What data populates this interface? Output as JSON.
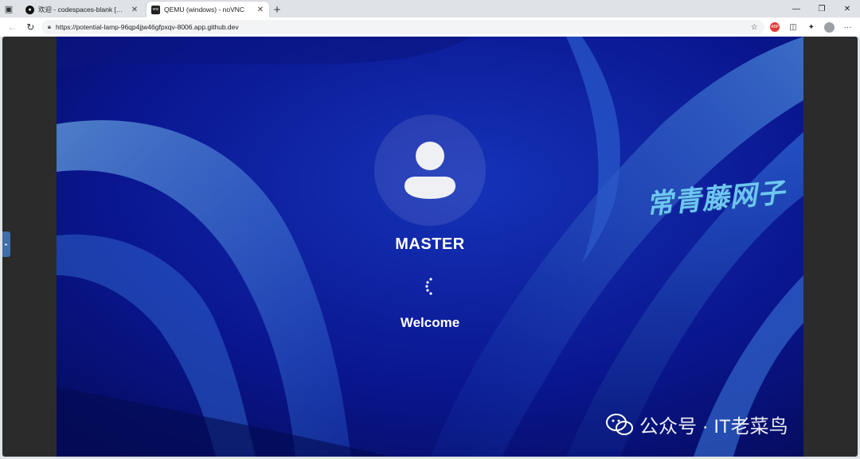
{
  "browser": {
    "tabs": [
      {
        "title": "欢迎 - codespaces-blank [Codes:",
        "favicon": "github-icon",
        "active": false
      },
      {
        "title": "QEMU (windows) - noVNC",
        "favicon": "novnc-icon",
        "active": true
      }
    ],
    "new_tab_label": "+",
    "url": "https://potential-lamp-96qp4jjw46gfpxqv-8006.app.github.dev",
    "ext_badge": "ABP"
  },
  "vnc": {
    "handle_glyph": "▸",
    "novnc_favicon_text": "vnc"
  },
  "login_screen": {
    "username": "MASTER",
    "status": "Welcome"
  },
  "overlays": {
    "watermark": "常青藤网子",
    "wechat_label": "公众号 · IT老菜鸟"
  },
  "colors": {
    "wallpaper_deep": "#0a128a",
    "wallpaper_mid": "#1a3fb8",
    "ribbon_light": "#4a90d8",
    "watermark": "#6ec6f2"
  }
}
